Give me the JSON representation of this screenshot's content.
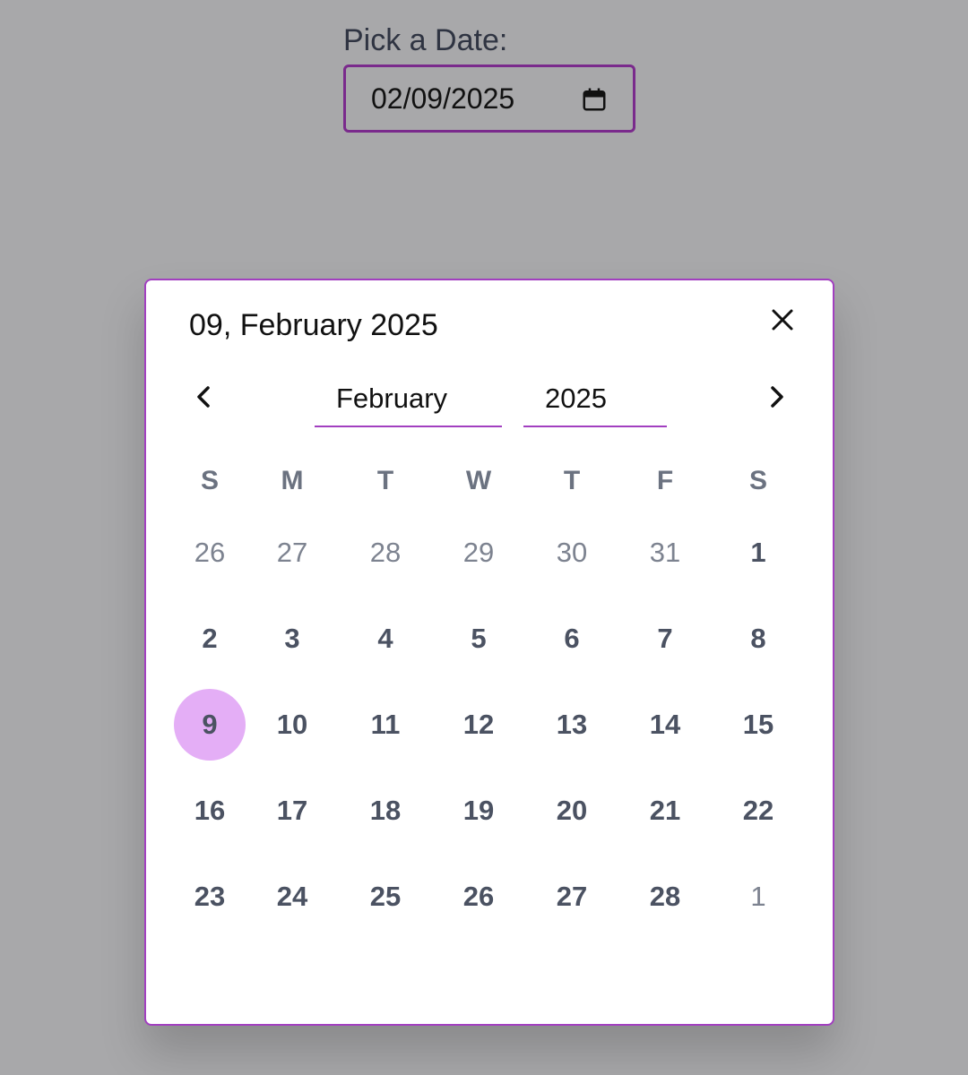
{
  "field": {
    "label": "Pick a Date:",
    "value": "02/09/2025",
    "calendar_icon": "calendar-icon"
  },
  "dialog": {
    "selected_title": "09, February 2025",
    "close_icon": "close-icon",
    "prev_icon": "chevron-left-icon",
    "next_icon": "chevron-right-icon",
    "month": "February",
    "year": "2025",
    "weekdays": [
      "S",
      "M",
      "T",
      "W",
      "T",
      "F",
      "S"
    ],
    "weeks": [
      [
        {
          "d": "26",
          "m": false
        },
        {
          "d": "27",
          "m": false
        },
        {
          "d": "28",
          "m": false
        },
        {
          "d": "29",
          "m": false
        },
        {
          "d": "30",
          "m": false
        },
        {
          "d": "31",
          "m": false
        },
        {
          "d": "1",
          "m": true
        }
      ],
      [
        {
          "d": "2",
          "m": true
        },
        {
          "d": "3",
          "m": true
        },
        {
          "d": "4",
          "m": true
        },
        {
          "d": "5",
          "m": true
        },
        {
          "d": "6",
          "m": true
        },
        {
          "d": "7",
          "m": true
        },
        {
          "d": "8",
          "m": true
        }
      ],
      [
        {
          "d": "9",
          "m": true,
          "selected": true
        },
        {
          "d": "10",
          "m": true
        },
        {
          "d": "11",
          "m": true
        },
        {
          "d": "12",
          "m": true
        },
        {
          "d": "13",
          "m": true
        },
        {
          "d": "14",
          "m": true
        },
        {
          "d": "15",
          "m": true
        }
      ],
      [
        {
          "d": "16",
          "m": true
        },
        {
          "d": "17",
          "m": true
        },
        {
          "d": "18",
          "m": true
        },
        {
          "d": "19",
          "m": true
        },
        {
          "d": "20",
          "m": true
        },
        {
          "d": "21",
          "m": true
        },
        {
          "d": "22",
          "m": true
        }
      ],
      [
        {
          "d": "23",
          "m": true
        },
        {
          "d": "24",
          "m": true
        },
        {
          "d": "25",
          "m": true
        },
        {
          "d": "26",
          "m": true
        },
        {
          "d": "27",
          "m": true
        },
        {
          "d": "28",
          "m": true
        },
        {
          "d": "1",
          "m": false
        }
      ]
    ]
  },
  "colors": {
    "backdrop": "#a8a8aa",
    "accent": "#a23fc0",
    "input_border": "#7a2a8c",
    "selected_day_bg": "#e4aef6"
  }
}
